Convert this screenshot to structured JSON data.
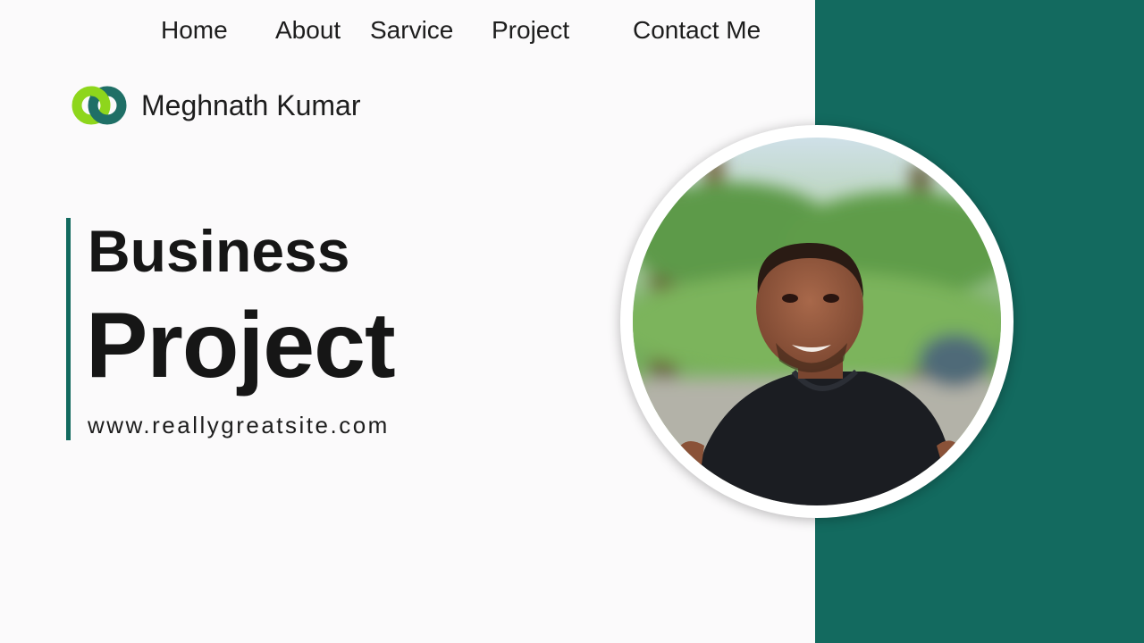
{
  "nav": {
    "items": [
      {
        "label": "Home"
      },
      {
        "label": "About"
      },
      {
        "label": "Sarvice"
      },
      {
        "label": "Project"
      },
      {
        "label": "Contact Me"
      }
    ]
  },
  "brand": {
    "name": "Meghnath Kumar",
    "logo_icon": "linked-rings-logo-icon"
  },
  "hero": {
    "title_line1": "Business",
    "title_line2": "Project",
    "website": "www.reallygreatsite.com"
  },
  "profile_photo": {
    "icon": "profile-photo"
  },
  "colors": {
    "accent_green": "#136a5f",
    "logo_lime": "#8ed61c",
    "logo_teal": "#1f6f66",
    "background": "#fbfafb",
    "text": "#161616"
  }
}
